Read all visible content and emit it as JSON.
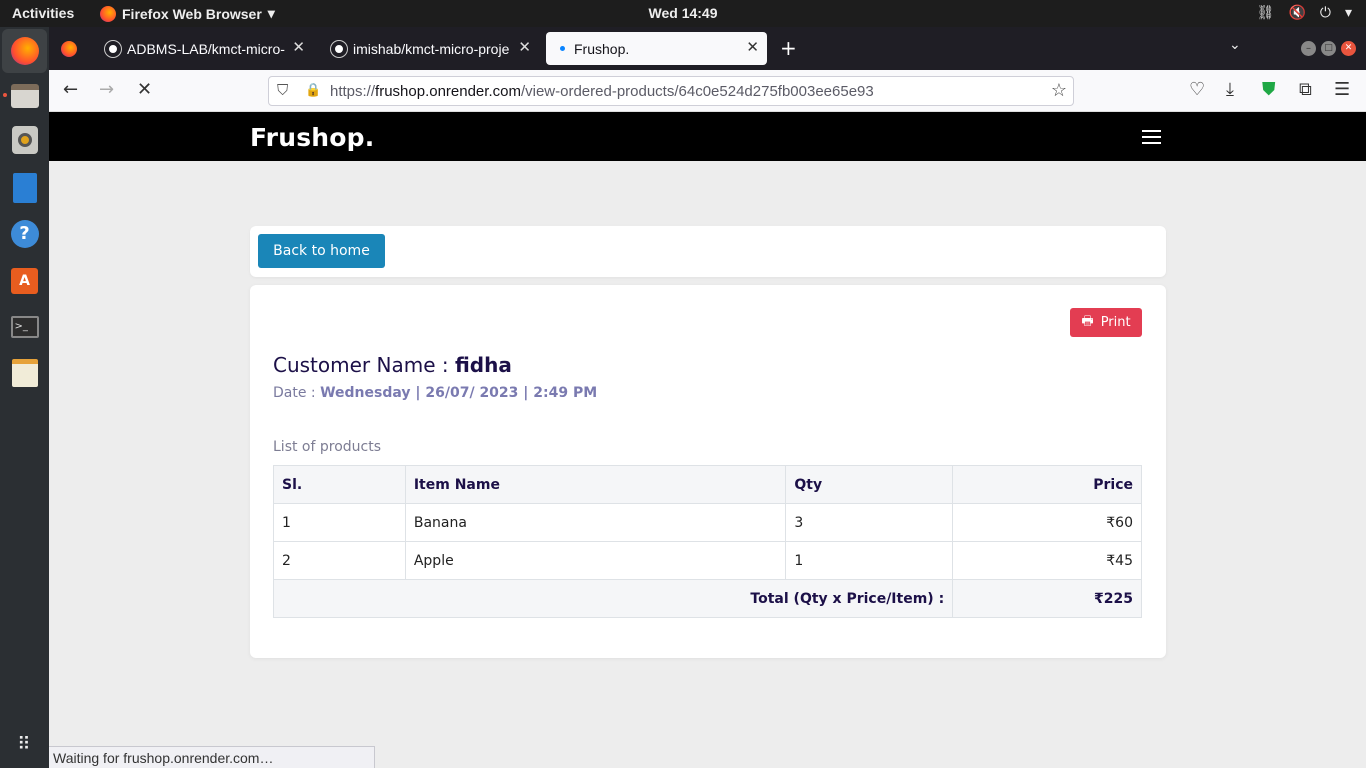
{
  "system": {
    "activities": "Activities",
    "app_name": "Firefox Web Browser",
    "clock": "Wed 14:49"
  },
  "tabs": [
    {
      "label": "ADBMS-LAB/kmct-micro-"
    },
    {
      "label": "imishab/kmct-micro-proje"
    },
    {
      "label": "Frushop."
    }
  ],
  "urlbar": {
    "prefix": "https://",
    "host": "frushop.onrender.com",
    "path": "/view-ordered-products/64c0e524d275fb003ee65e93"
  },
  "site": {
    "brand": "Frushop.",
    "back_label": "Back to home",
    "print_label": "Print"
  },
  "order": {
    "customer_label": "Customer Name : ",
    "customer_name": "fidha",
    "date_label": "Date : ",
    "date_value": "Wednesday | 26/07/ 2023 | 2:49 PM",
    "list_label": "List of products",
    "columns": [
      "Sl.",
      "Item Name",
      "Qty",
      "Price"
    ],
    "rows": [
      {
        "sl": "1",
        "item": "Banana",
        "qty": "3",
        "price": "₹60"
      },
      {
        "sl": "2",
        "item": "Apple",
        "qty": "1",
        "price": "₹45"
      }
    ],
    "total_label": "Total (Qty x Price/Item) :",
    "total_value": "₹225"
  },
  "status": "Waiting for frushop.onrender.com…",
  "colors": {
    "brand_bar": "#000000",
    "primary": "#1a86b8",
    "danger": "#e33d52",
    "heading": "#1c1048"
  }
}
